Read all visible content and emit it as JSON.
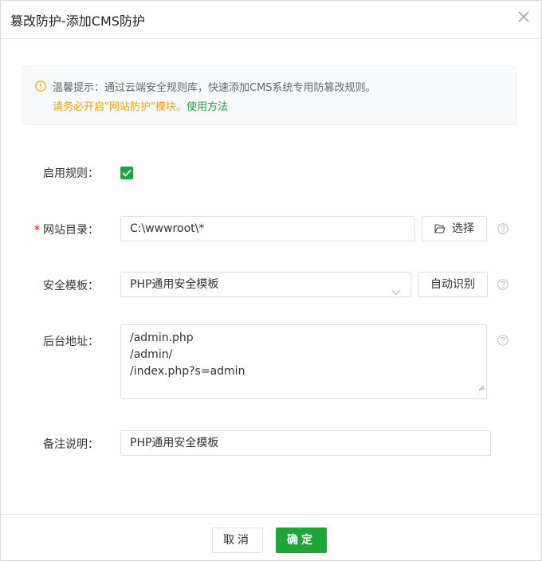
{
  "dialog": {
    "title": "篡改防护-添加CMS防护",
    "close_icon": "close-icon"
  },
  "tip": {
    "line1": "温馨提示：通过云端安全规则库，快速添加CMS系统专用防篡改规则。",
    "warning": "请务必开启\"网站防护\"模块。",
    "link": "使用方法",
    "icon": "info-circle-icon",
    "warn_color": "#f2a10b",
    "link_color": "#20a53a"
  },
  "form": {
    "enable_rule": {
      "label": "启用规则：",
      "checked": true
    },
    "site_dir": {
      "required_mark": "*",
      "label": "网站目录：",
      "value": "C:\\wwwroot\\*",
      "select_button": "选择",
      "button_icon": "folder-open-icon"
    },
    "template": {
      "label": "安全模板：",
      "value": "PHP通用安全模板",
      "auto_button": "自动识别"
    },
    "admin_url": {
      "label": "后台地址：",
      "lines": [
        "/admin.php",
        "/admin/",
        "/index.php?s=admin"
      ]
    },
    "remark": {
      "label": "备注说明：",
      "value": "PHP通用安全模板"
    }
  },
  "footer": {
    "cancel": "取消",
    "confirm": "确定",
    "primary_color": "#20a53a"
  }
}
